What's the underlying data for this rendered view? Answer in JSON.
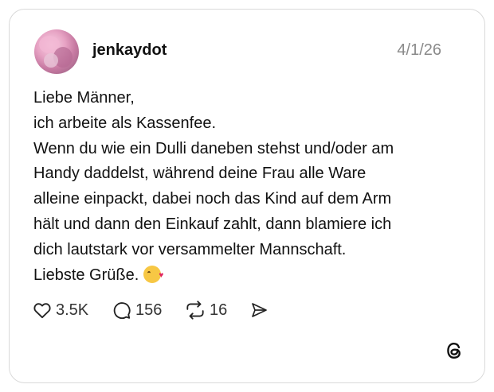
{
  "post": {
    "username": "jenkaydot",
    "date": "4/1/26",
    "text": "Liebe Männer,\nich arbeite als Kassenfee.\nWenn du wie ein Dulli daneben stehst und/oder am\nHandy daddelst, während deine Frau alle Ware\nalleine einpackt, dabei noch das Kind auf dem Arm\nhält und dann den Einkauf zahlt, dann blamiere ich\ndich lautstark vor versammelter Mannschaft.\nLiebste Grüße.",
    "emoji": "face-blowing-a-kiss"
  },
  "actions": {
    "likes": "3.5K",
    "replies": "156",
    "reposts": "16",
    "icons": [
      "heart-icon",
      "comment-icon",
      "repost-icon",
      "share-icon"
    ]
  },
  "branding": {
    "logo": "threads-logo-icon"
  },
  "colors": {
    "text": "#111111",
    "muted": "#8a8a8a",
    "border": "#d9d9d9"
  }
}
